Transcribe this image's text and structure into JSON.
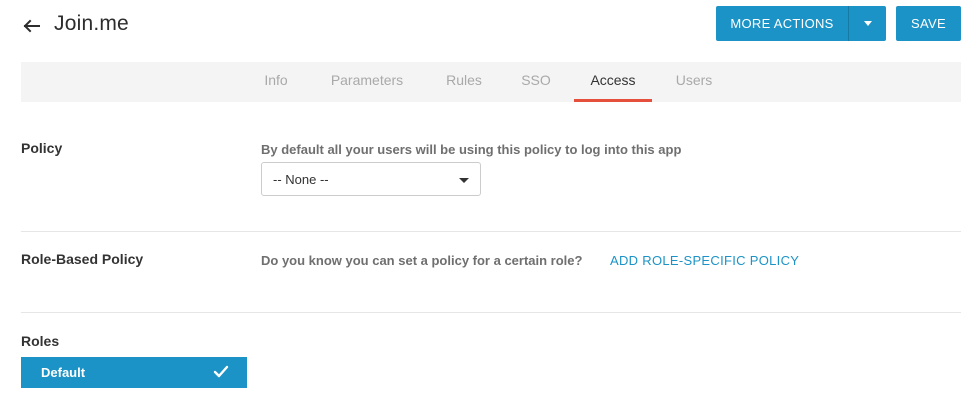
{
  "header": {
    "title": "Join.me",
    "more_actions_label": "MORE ACTIONS",
    "save_label": "SAVE"
  },
  "tabs": [
    {
      "label": "Info",
      "active": false
    },
    {
      "label": "Parameters",
      "active": false
    },
    {
      "label": "Rules",
      "active": false
    },
    {
      "label": "SSO",
      "active": false
    },
    {
      "label": "Access",
      "active": true
    },
    {
      "label": "Users",
      "active": false
    }
  ],
  "policy": {
    "label": "Policy",
    "help": "By default all your users will be using this policy to log into this app",
    "selected": "-- None --"
  },
  "role_based": {
    "label": "Role-Based Policy",
    "help": "Do you know you can set a policy for a certain role?",
    "link": "ADD ROLE-SPECIFIC POLICY"
  },
  "roles": {
    "label": "Roles",
    "items": [
      {
        "label": "Default",
        "selected": true
      }
    ]
  },
  "colors": {
    "accent": "#1c93c6",
    "active_tab_underline": "#e5503d",
    "tabbar_bg": "#f4f4f4"
  },
  "icons": {
    "back": "arrow-left-icon",
    "dropdown": "caret-down-icon",
    "check": "check-icon"
  }
}
